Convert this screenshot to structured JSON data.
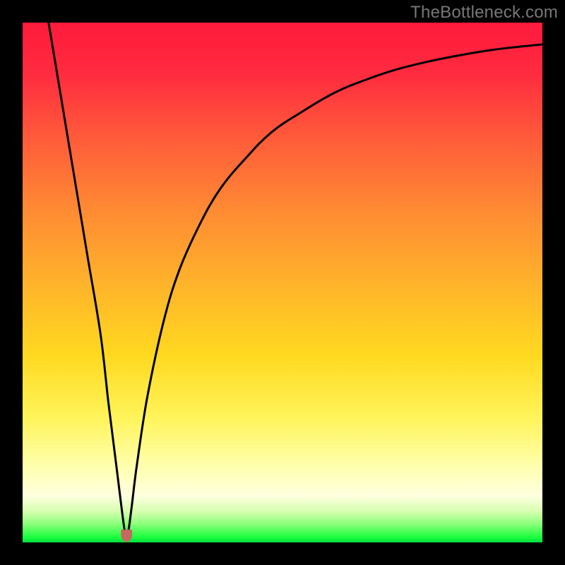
{
  "watermark": "TheBottleneck.com",
  "colors": {
    "frame": "#000000",
    "curve_stroke": "#000000",
    "marker_fill": "#c46a60",
    "marker_stroke": "#c46a60"
  },
  "chart_data": {
    "type": "line",
    "title": "",
    "xlabel": "",
    "ylabel": "",
    "xlim": [
      0,
      100
    ],
    "ylim": [
      0,
      100
    ],
    "grid": false,
    "legend": false,
    "annotations": [],
    "series": [
      {
        "name": "bottleneck-curve",
        "x": [
          5,
          7.5,
          10,
          12.5,
          15,
          16.5,
          18,
          19,
          19.6,
          20,
          20.4,
          21,
          22,
          24,
          27,
          30,
          34,
          38,
          43,
          48,
          54,
          60,
          66,
          72,
          78,
          84,
          90,
          95,
          100
        ],
        "y": [
          100,
          85,
          70,
          55,
          40,
          27,
          15,
          7,
          2.5,
          1.5,
          2.5,
          7,
          15,
          28,
          42,
          52,
          61,
          68,
          74,
          79,
          83,
          86.5,
          89,
          91,
          92.5,
          93.7,
          94.7,
          95.3,
          95.8
        ]
      }
    ],
    "marker": {
      "name": "minimum-marker",
      "x_range": [
        19,
        21
      ],
      "y": 1.5,
      "shape": "u"
    },
    "background_gradient": {
      "orientation": "vertical",
      "stops": [
        {
          "pos": 0.0,
          "color": "#ff1a3c"
        },
        {
          "pos": 0.5,
          "color": "#ffb22b"
        },
        {
          "pos": 0.8,
          "color": "#fff45a"
        },
        {
          "pos": 0.94,
          "color": "#d7ffb0"
        },
        {
          "pos": 1.0,
          "color": "#00e040"
        }
      ]
    }
  }
}
